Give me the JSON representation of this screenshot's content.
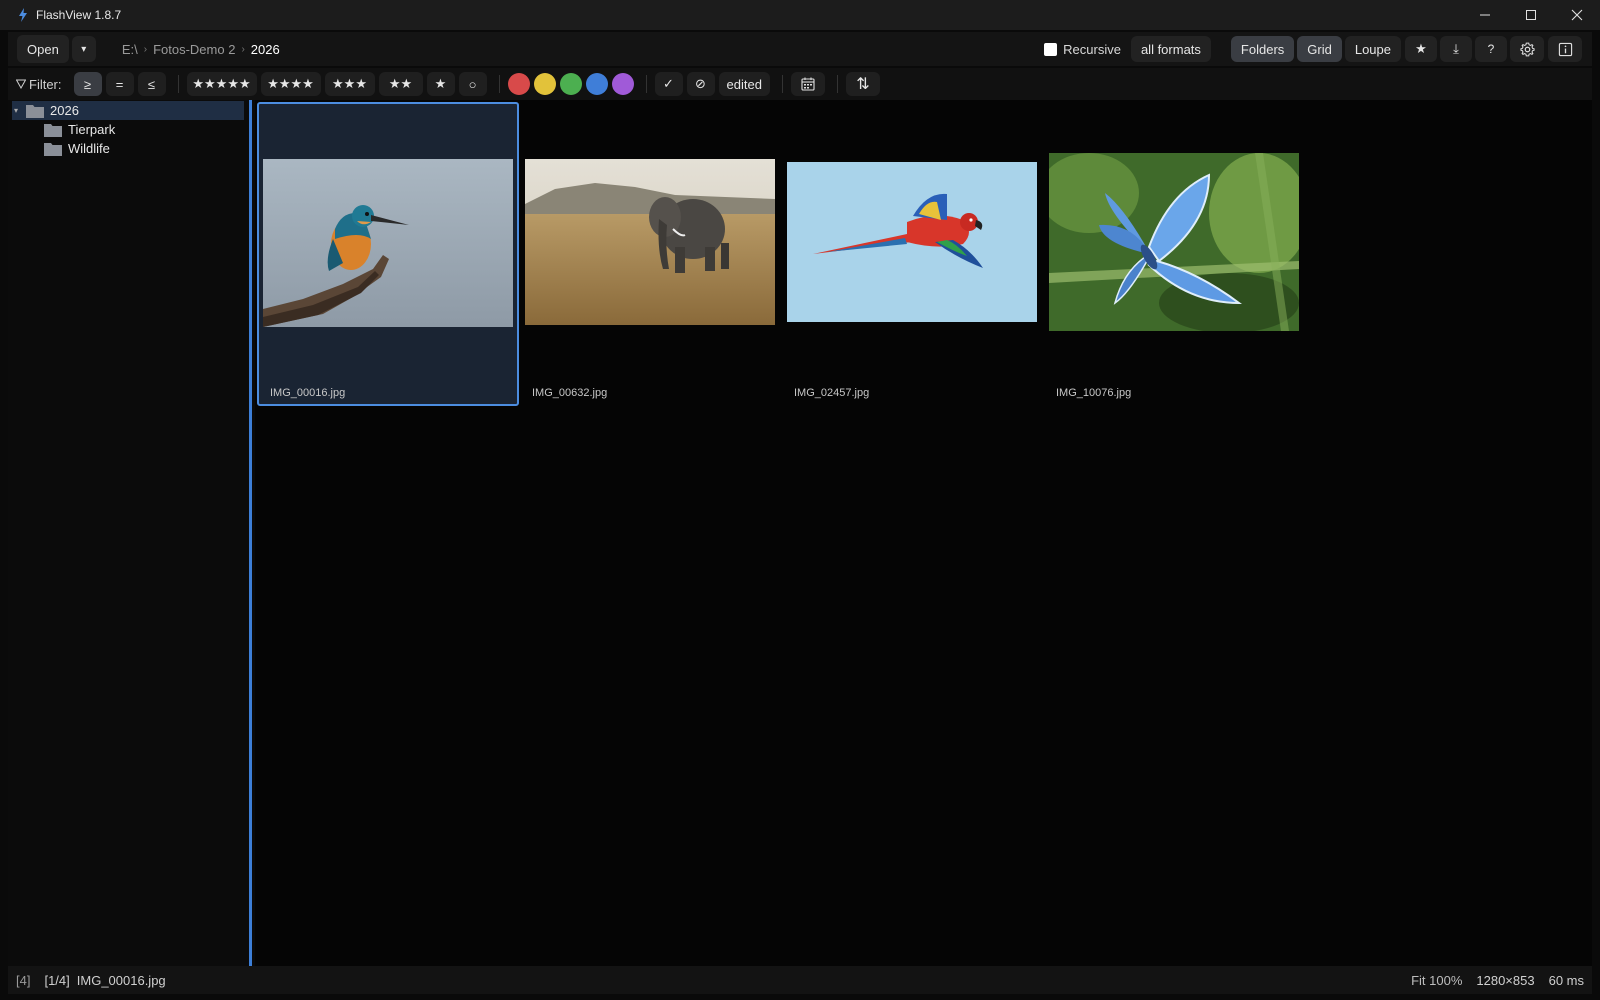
{
  "window": {
    "title": "FlashView 1.8.7"
  },
  "toolbar": {
    "open_label": "Open",
    "open_dropdown": "▾",
    "breadcrumb": [
      "E:\\",
      "Fotos-Demo 2",
      "2026"
    ],
    "breadcrumb_separator": "›",
    "recursive_label": "Recursive",
    "recursive_checked": false,
    "formats_label": "all formats",
    "views": [
      "Folders",
      "Grid",
      "Loupe"
    ],
    "icons": {
      "star": "★",
      "download": "⤓",
      "help": "?",
      "settings": "gear-icon",
      "info": "info-icon"
    }
  },
  "filter": {
    "label": "Filter:",
    "compare": [
      "≥",
      "=",
      "≤"
    ],
    "compare_active": "≥",
    "ratings": [
      "★★★★★",
      "★★★★",
      "★★★",
      "★★",
      "★",
      "○"
    ],
    "colors": [
      "#d84a4a",
      "#e2c23a",
      "#4caf50",
      "#3f7ed8",
      "#a05ad8"
    ],
    "check": "✓",
    "reject": "⊘",
    "edited_label": "edited",
    "calendar_icon": "calendar-icon",
    "sort_icon": "⇅"
  },
  "sidebar": {
    "tree": [
      {
        "label": "2026",
        "level": 0,
        "expanded": true,
        "selected": true
      },
      {
        "label": "Tierpark",
        "level": 1
      },
      {
        "label": "Wildlife",
        "level": 1
      }
    ]
  },
  "grid": {
    "items": [
      {
        "name": "IMG_00016.jpg",
        "subject": "kingfisher",
        "selected": true
      },
      {
        "name": "IMG_00632.jpg",
        "subject": "elephant"
      },
      {
        "name": "IMG_02457.jpg",
        "subject": "macaw"
      },
      {
        "name": "IMG_10076.jpg",
        "subject": "blue-butterfly"
      }
    ]
  },
  "status": {
    "count": "[4]",
    "position": "[1/4]",
    "file": "IMG_00016.jpg",
    "zoom": "Fit 100%",
    "dimensions": "1280×853",
    "time": "60 ms"
  },
  "colors": {
    "accent": "#4c8de0",
    "selection": "#1f2e44"
  }
}
